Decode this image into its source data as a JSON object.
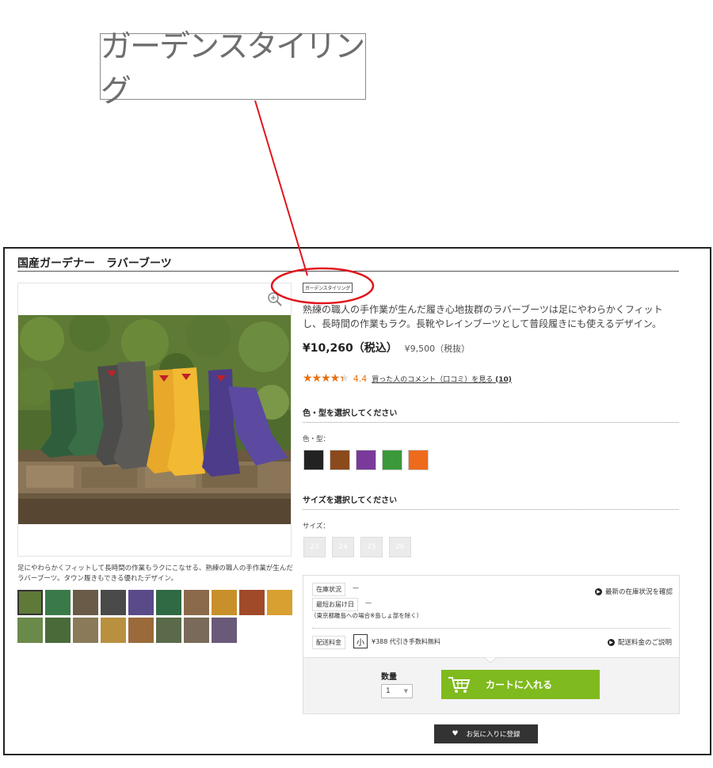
{
  "callout": {
    "logo_text": "ガーデンスタイリング"
  },
  "product": {
    "title": "国産ガーデナー　ラバーブーツ",
    "brand_logo": "ガーデンスタイリング",
    "description": "熟練の職人の手作業が生んだ履き心地抜群のラバーブーツは足にやわらかくフィットし、長時間の作業もラク。長靴やレインブーツとして普段履きにも使えるデザイン。",
    "price_incl": "¥10,260（税込）",
    "price_excl": "¥9,500（税抜）",
    "rating_stars": "★★★★★",
    "rating_value": "4.4",
    "rating_value_fraction": 0.88,
    "reviews_link": "買った人のコメント（口コミ）を見る",
    "reviews_count": "(10)",
    "image_caption": "足にやわらかくフィットして長時間の作業もラクにこなせる、熟練の職人の手作業が生んだラバーブーツ。タウン履きもできる優れたデザイン。"
  },
  "variant": {
    "section_title": "色・型を選択してください",
    "label": "色・型：",
    "swatch_colors": [
      "#222222",
      "#8b4a1c",
      "#7a3a9a",
      "#3a9a3a",
      "#ee6a1c"
    ]
  },
  "size": {
    "section_title": "サイズを選択してください",
    "label": "サイズ：",
    "options": [
      "23",
      "24",
      "25",
      "26"
    ]
  },
  "stock": {
    "status_label": "在庫状況",
    "status_value": "—",
    "latest_link": "最新の在庫状況を確認",
    "delivery_label": "最短お届け日",
    "delivery_value": "—",
    "delivery_note": "（東京都離島への場合※島しょ部を除く）",
    "shipping_label": "配送料金",
    "shipping_size": "小",
    "shipping_value": "¥388 代引き手数料無料",
    "shipping_link": "配送料金のご説明"
  },
  "purchase": {
    "qty_label": "数量",
    "qty_value": "1",
    "cart_button": "カートに入れる",
    "fav_button": "お気に入りに登録"
  },
  "colors": {
    "cart_green": "#7fba1e",
    "rating_orange": "#e9700f",
    "callout_red": "#e0151b"
  }
}
